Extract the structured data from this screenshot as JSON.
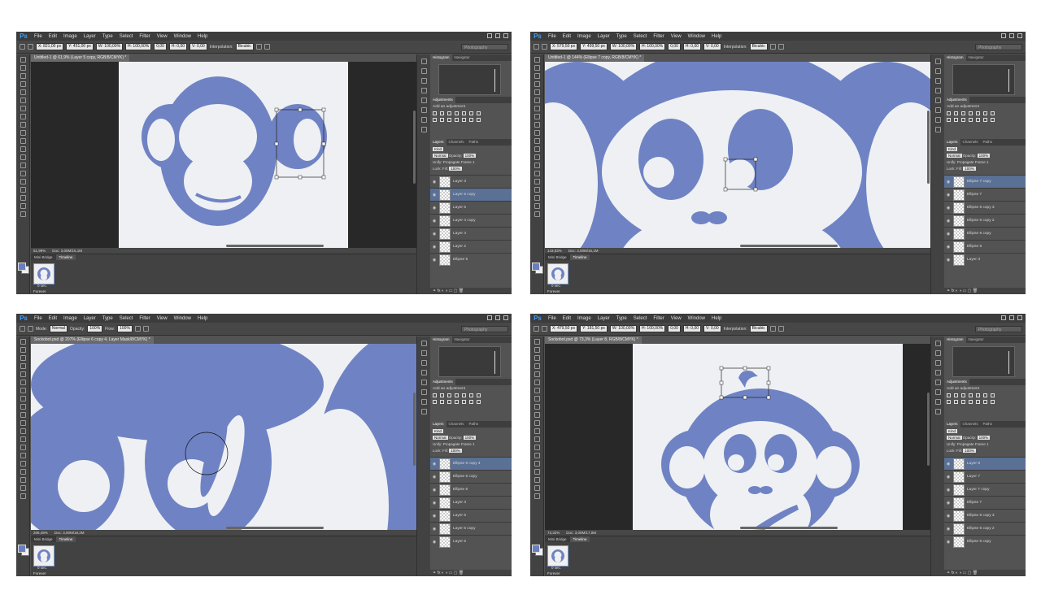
{
  "menu": [
    "File",
    "Edit",
    "Image",
    "Layer",
    "Type",
    "Select",
    "Filter",
    "View",
    "Window",
    "Help"
  ],
  "app_logo": "Ps",
  "colors": {
    "monkey": "#6f83c4",
    "canvas": "#eef0f3",
    "chrome": "#535353",
    "selected": "#5a7094"
  },
  "panel_tabs": {
    "histogram": "Histogram",
    "navigator": "Navigator",
    "adjustments": "Adjustments",
    "layers": "Layers",
    "channels": "Channels",
    "paths": "Paths"
  },
  "adjustments_label": "Add an adjustment",
  "timeline_tabs": {
    "mini_bridge": "Mini Bridge",
    "timeline": "Timeline"
  },
  "timeline_duration": "0 sec.",
  "timeline_loop": "Forever",
  "layer_opts": {
    "kind": "Kind",
    "blend": "Normal",
    "opacity_label": "Opacity:",
    "opacity_value": "100%",
    "unify": "Unify:",
    "propagate": "Propagate Frame 1",
    "lock": "Lock:",
    "fill_label": "Fill:",
    "fill_value": "100%"
  },
  "panes": [
    {
      "optbar": [
        "X: 821,00 px",
        "Y: 451,00 px",
        "W: 100,00%",
        "H: 100,00%",
        "0,00",
        "H: 0,00",
        "V: 0,00",
        "Interpolation:",
        "Bicubic"
      ],
      "doc_tab": "Untitled-1 @ 61,9% (Layer 5 copy, RGB/8/CMYK) *",
      "zoom": "61,99%",
      "doc_size": "Doc: 3,00M/15,1M",
      "workspace": "Photography",
      "layers": [
        {
          "name": "Layer 3",
          "selected": false
        },
        {
          "name": "Layer 5 copy",
          "selected": true
        },
        {
          "name": "Layer 5",
          "selected": false
        },
        {
          "name": "Layer 4 copy",
          "selected": false
        },
        {
          "name": "Layer 4",
          "selected": false
        },
        {
          "name": "Layer 2",
          "selected": false
        },
        {
          "name": "Ellipse 5",
          "selected": false
        }
      ]
    },
    {
      "optbar": [
        "X: 579,50 px",
        "Y: 499,50 px",
        "W: 100,00%",
        "H: 100,00%",
        "0,00",
        "H: 0,00",
        "V: 0,00",
        "Interpolation:",
        "Bicubic"
      ],
      "doc_tab": "Untitled-1 @ 144% (Ellipse 7 copy, RGB/8/CMYK) *",
      "zoom": "143,83%",
      "doc_size": "Doc: 3,00M/16,1M",
      "workspace": "Photography",
      "layers": [
        {
          "name": "Ellipse 7 copy",
          "selected": true
        },
        {
          "name": "Ellipse 7",
          "selected": false
        },
        {
          "name": "Ellipse 6 copy 3",
          "selected": false
        },
        {
          "name": "Ellipse 6 copy 2",
          "selected": false
        },
        {
          "name": "Ellipse 6 copy",
          "selected": false
        },
        {
          "name": "Ellipse 6",
          "selected": false
        },
        {
          "name": "Layer 3",
          "selected": false
        }
      ]
    },
    {
      "optbar": [
        "Mode:",
        "Normal",
        "Opacity:",
        "100%",
        "Flow:",
        "100%"
      ],
      "doc_tab": "Sockobot.psd @ 207% (Ellipse 6 copy 4, Layer Mask/8/CMYK) *",
      "zoom": "206,49%",
      "doc_size": "Doc: 3,00M/18,2M",
      "workspace": "Photography",
      "layers": [
        {
          "name": "Ellipse 6 copy 4",
          "selected": true
        },
        {
          "name": "Ellipse 6 copy",
          "selected": false
        },
        {
          "name": "Ellipse 6",
          "selected": false
        },
        {
          "name": "Layer 3",
          "selected": false
        },
        {
          "name": "Layer 6",
          "selected": false
        },
        {
          "name": "Layer 5 copy",
          "selected": false
        },
        {
          "name": "Layer 5",
          "selected": false
        }
      ]
    },
    {
      "optbar": [
        "X: 479,50 px",
        "Y: 181,50 px",
        "W: 100,00%",
        "H: 100,00%",
        "0,00",
        "H: 0,00",
        "V: 0,00",
        "Interpolation:",
        "Bicubic"
      ],
      "doc_tab": "Sockobot.psd @ 73,3% (Layer 8, RGB/8/CMYK) *",
      "zoom": "73,32%",
      "doc_size": "Doc: 3,00M/17,0M",
      "workspace": "Photography",
      "layers": [
        {
          "name": "Layer 8",
          "selected": true
        },
        {
          "name": "Layer 7",
          "selected": false
        },
        {
          "name": "Layer 7 copy",
          "selected": false
        },
        {
          "name": "Ellipse 7",
          "selected": false
        },
        {
          "name": "Ellipse 6 copy 3",
          "selected": false
        },
        {
          "name": "Ellipse 6 copy 2",
          "selected": false
        },
        {
          "name": "Ellipse 6 copy",
          "selected": false
        }
      ]
    }
  ]
}
